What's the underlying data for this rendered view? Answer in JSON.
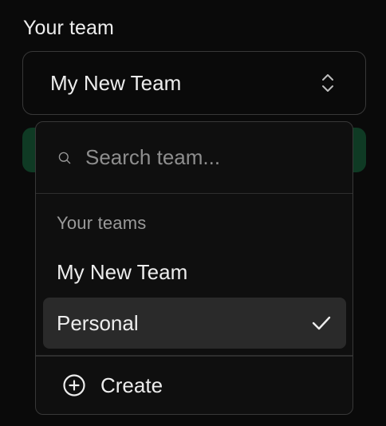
{
  "field": {
    "label": "Your team",
    "selected_value": "My New Team"
  },
  "search": {
    "placeholder": "Search team...",
    "value": ""
  },
  "dropdown": {
    "group_heading": "Your teams",
    "options": [
      {
        "label": "My New Team",
        "selected": false
      },
      {
        "label": "Personal",
        "selected": true
      }
    ],
    "create_label": "Create"
  },
  "icons": {
    "select_indicator": "chevrons-up-down-icon",
    "search": "search-icon",
    "selected_mark": "check-icon",
    "create": "plus-circle-icon"
  },
  "colors": {
    "background": "#0a0a0a",
    "border": "#383838",
    "highlight_row": "#2a2a2a",
    "accent_green": "#0f3a24",
    "text": "#ededed",
    "muted_text": "#9a9a9a"
  }
}
